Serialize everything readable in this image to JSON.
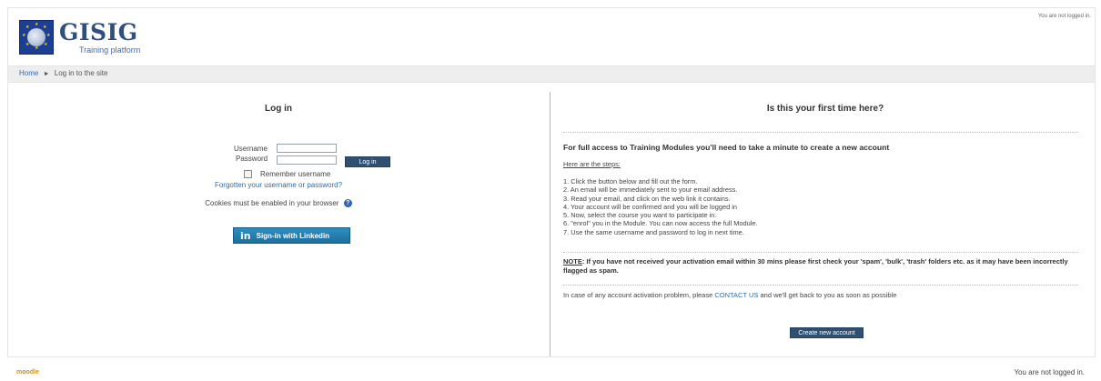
{
  "header": {
    "logo_title": "GISIG",
    "logo_subtitle": "Training platform",
    "login_info": "You are not logged in."
  },
  "breadcrumb": {
    "home": "Home",
    "separator": "►",
    "current": "Log in to the site"
  },
  "login": {
    "title": "Log in",
    "username_label": "Username",
    "password_label": "Password",
    "username_value": "",
    "password_value": "",
    "login_button": "Log in",
    "remember_label": "Remember username",
    "remember_checked": false,
    "forgot_link": "Forgotten your username or password?",
    "cookies_text": "Cookies must be enabled in your browser",
    "help_icon_glyph": "?",
    "linkedin_icon_glyph": "in",
    "linkedin_button": "Sign-in with Linkedin"
  },
  "signup": {
    "title": "Is this your first time here?",
    "heading": "For full access to Training Modules you'll need to take a minute to create a new account",
    "steps_heading": "Here are the steps:",
    "steps": [
      "1. Click the button below and fill out the form.",
      "2. An email will be immediately sent to your email address.",
      "3. Read your email, and click on the web link it contains.",
      "4. Your account will be confirmed and you will be logged in",
      "5. Now, select the course you want to participate in.",
      "6. \"enrol\" you in the Module. You can now access the full Module.",
      "7. Use the same username and password to log in next time."
    ],
    "note_label": "NOTE",
    "note_text": ": If you have not received your activation email within 30 mins please first check your 'spam', 'bulk', 'trash' folders etc. as it may have been incorrectly flagged as spam.",
    "contact_before": "In case of any account activation problem, please ",
    "contact_link": "CONTACT US",
    "contact_after": " and we'll get back to you as soon as possible",
    "create_button": "Create new account"
  },
  "footer": {
    "logo": "moodle",
    "login_info": "You are not logged in."
  },
  "colors": {
    "button_bg": "#2f4f73",
    "link": "#2b6cb0",
    "linkedin": "#1d6f9f",
    "moodle_orange": "#e08a00"
  }
}
